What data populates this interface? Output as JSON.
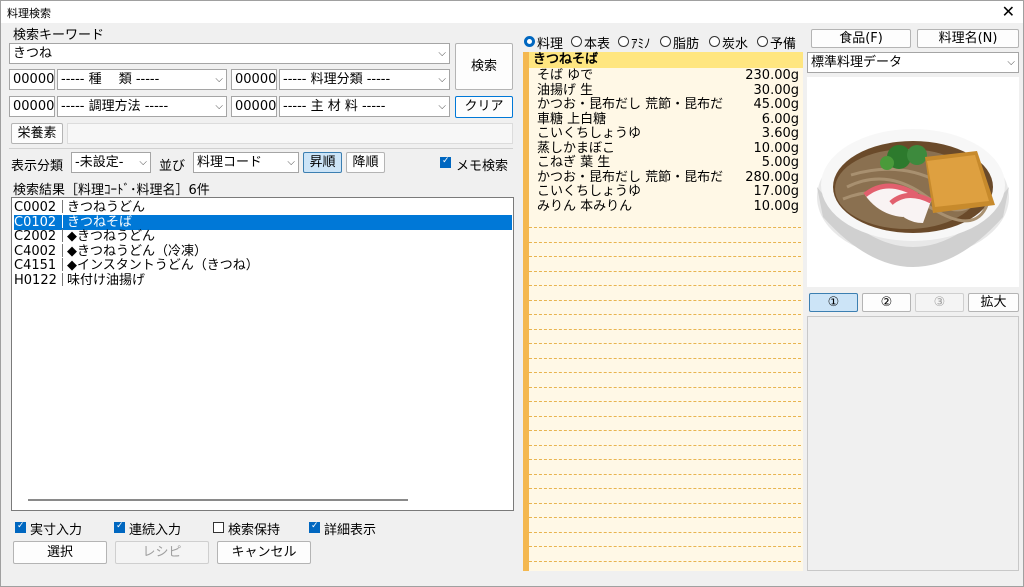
{
  "window": {
    "title": "料理検索",
    "close_label": "✕"
  },
  "search": {
    "section_label": "検索キーワード",
    "keyword_value": "きつね",
    "search_button": "検索",
    "clear_button": "クリア",
    "filters": [
      {
        "code": "00000",
        "label": "----- 種　 類 -----"
      },
      {
        "code": "00000",
        "label": "----- 料理分類 -----"
      },
      {
        "code": "00000",
        "label": "----- 調理方法 -----"
      },
      {
        "code": "00000",
        "label": "----- 主 材 料 -----"
      }
    ],
    "nutrient_button": "栄養素"
  },
  "display": {
    "category_label": "表示分類",
    "category_value": "-未設定-",
    "sort_label": "並び",
    "sort_value": "料理コード",
    "asc_button": "昇順",
    "desc_button": "降順",
    "memo_search_label": "メモ検索",
    "memo_search_checked": true
  },
  "results": {
    "header": "検索結果［料理ｺｰﾄﾞ･料理名］6件",
    "rows": [
      {
        "code": "C0002",
        "name": "きつねうどん",
        "selected": false
      },
      {
        "code": "C0102",
        "name": "きつねそば",
        "selected": true
      },
      {
        "code": "C2002",
        "name": "◆きつねうどん",
        "selected": false
      },
      {
        "code": "C4002",
        "name": "◆きつねうどん（冷凍）",
        "selected": false
      },
      {
        "code": "C4151",
        "name": "◆インスタントうどん（きつね）",
        "selected": false
      },
      {
        "code": "H0122",
        "name": "味付け油揚げ",
        "selected": false
      }
    ]
  },
  "options": [
    {
      "label": "実寸入力",
      "checked": true
    },
    {
      "label": "連続入力",
      "checked": true
    },
    {
      "label": "検索保持",
      "checked": false
    },
    {
      "label": "詳細表示",
      "checked": true
    }
  ],
  "actions": {
    "select": "選択",
    "recipe": "レシピ",
    "cancel": "キャンセル"
  },
  "view_tabs": [
    {
      "label": "料理",
      "selected": true
    },
    {
      "label": "本表",
      "selected": false
    },
    {
      "label": "ｱﾐﾉ",
      "selected": false
    },
    {
      "label": "脂肪",
      "selected": false
    },
    {
      "label": "炭水",
      "selected": false
    },
    {
      "label": "予備",
      "selected": false
    }
  ],
  "ingredients": {
    "title": "きつねそば",
    "rows": [
      {
        "name": "そば ゆで",
        "amount": "230.00g"
      },
      {
        "name": "油揚げ 生",
        "amount": "30.00g"
      },
      {
        "name": "かつお・昆布だし 荒節・昆布だ",
        "amount": "45.00g"
      },
      {
        "name": "車糖 上白糖",
        "amount": "6.00g"
      },
      {
        "name": "こいくちしょうゆ",
        "amount": "3.60g"
      },
      {
        "name": "蒸しかまぼこ",
        "amount": "10.00g"
      },
      {
        "name": "こねぎ 葉 生",
        "amount": "5.00g"
      },
      {
        "name": "かつお・昆布だし 荒節・昆布だ",
        "amount": "280.00g"
      },
      {
        "name": "こいくちしょうゆ",
        "amount": "17.00g"
      },
      {
        "name": "みりん 本みりん",
        "amount": "10.00g"
      }
    ]
  },
  "right": {
    "food_button": "食品(F)",
    "dishname_button": "料理名(N)",
    "data_select": "標準料理データ",
    "photo_buttons": [
      "①",
      "②",
      "③"
    ],
    "zoom_button": "拡大"
  },
  "colors": {
    "accent": "#0078d7",
    "list_title_bg": "#ffe680",
    "list_bg": "#fff8e6",
    "stripe": "#f4b850"
  }
}
